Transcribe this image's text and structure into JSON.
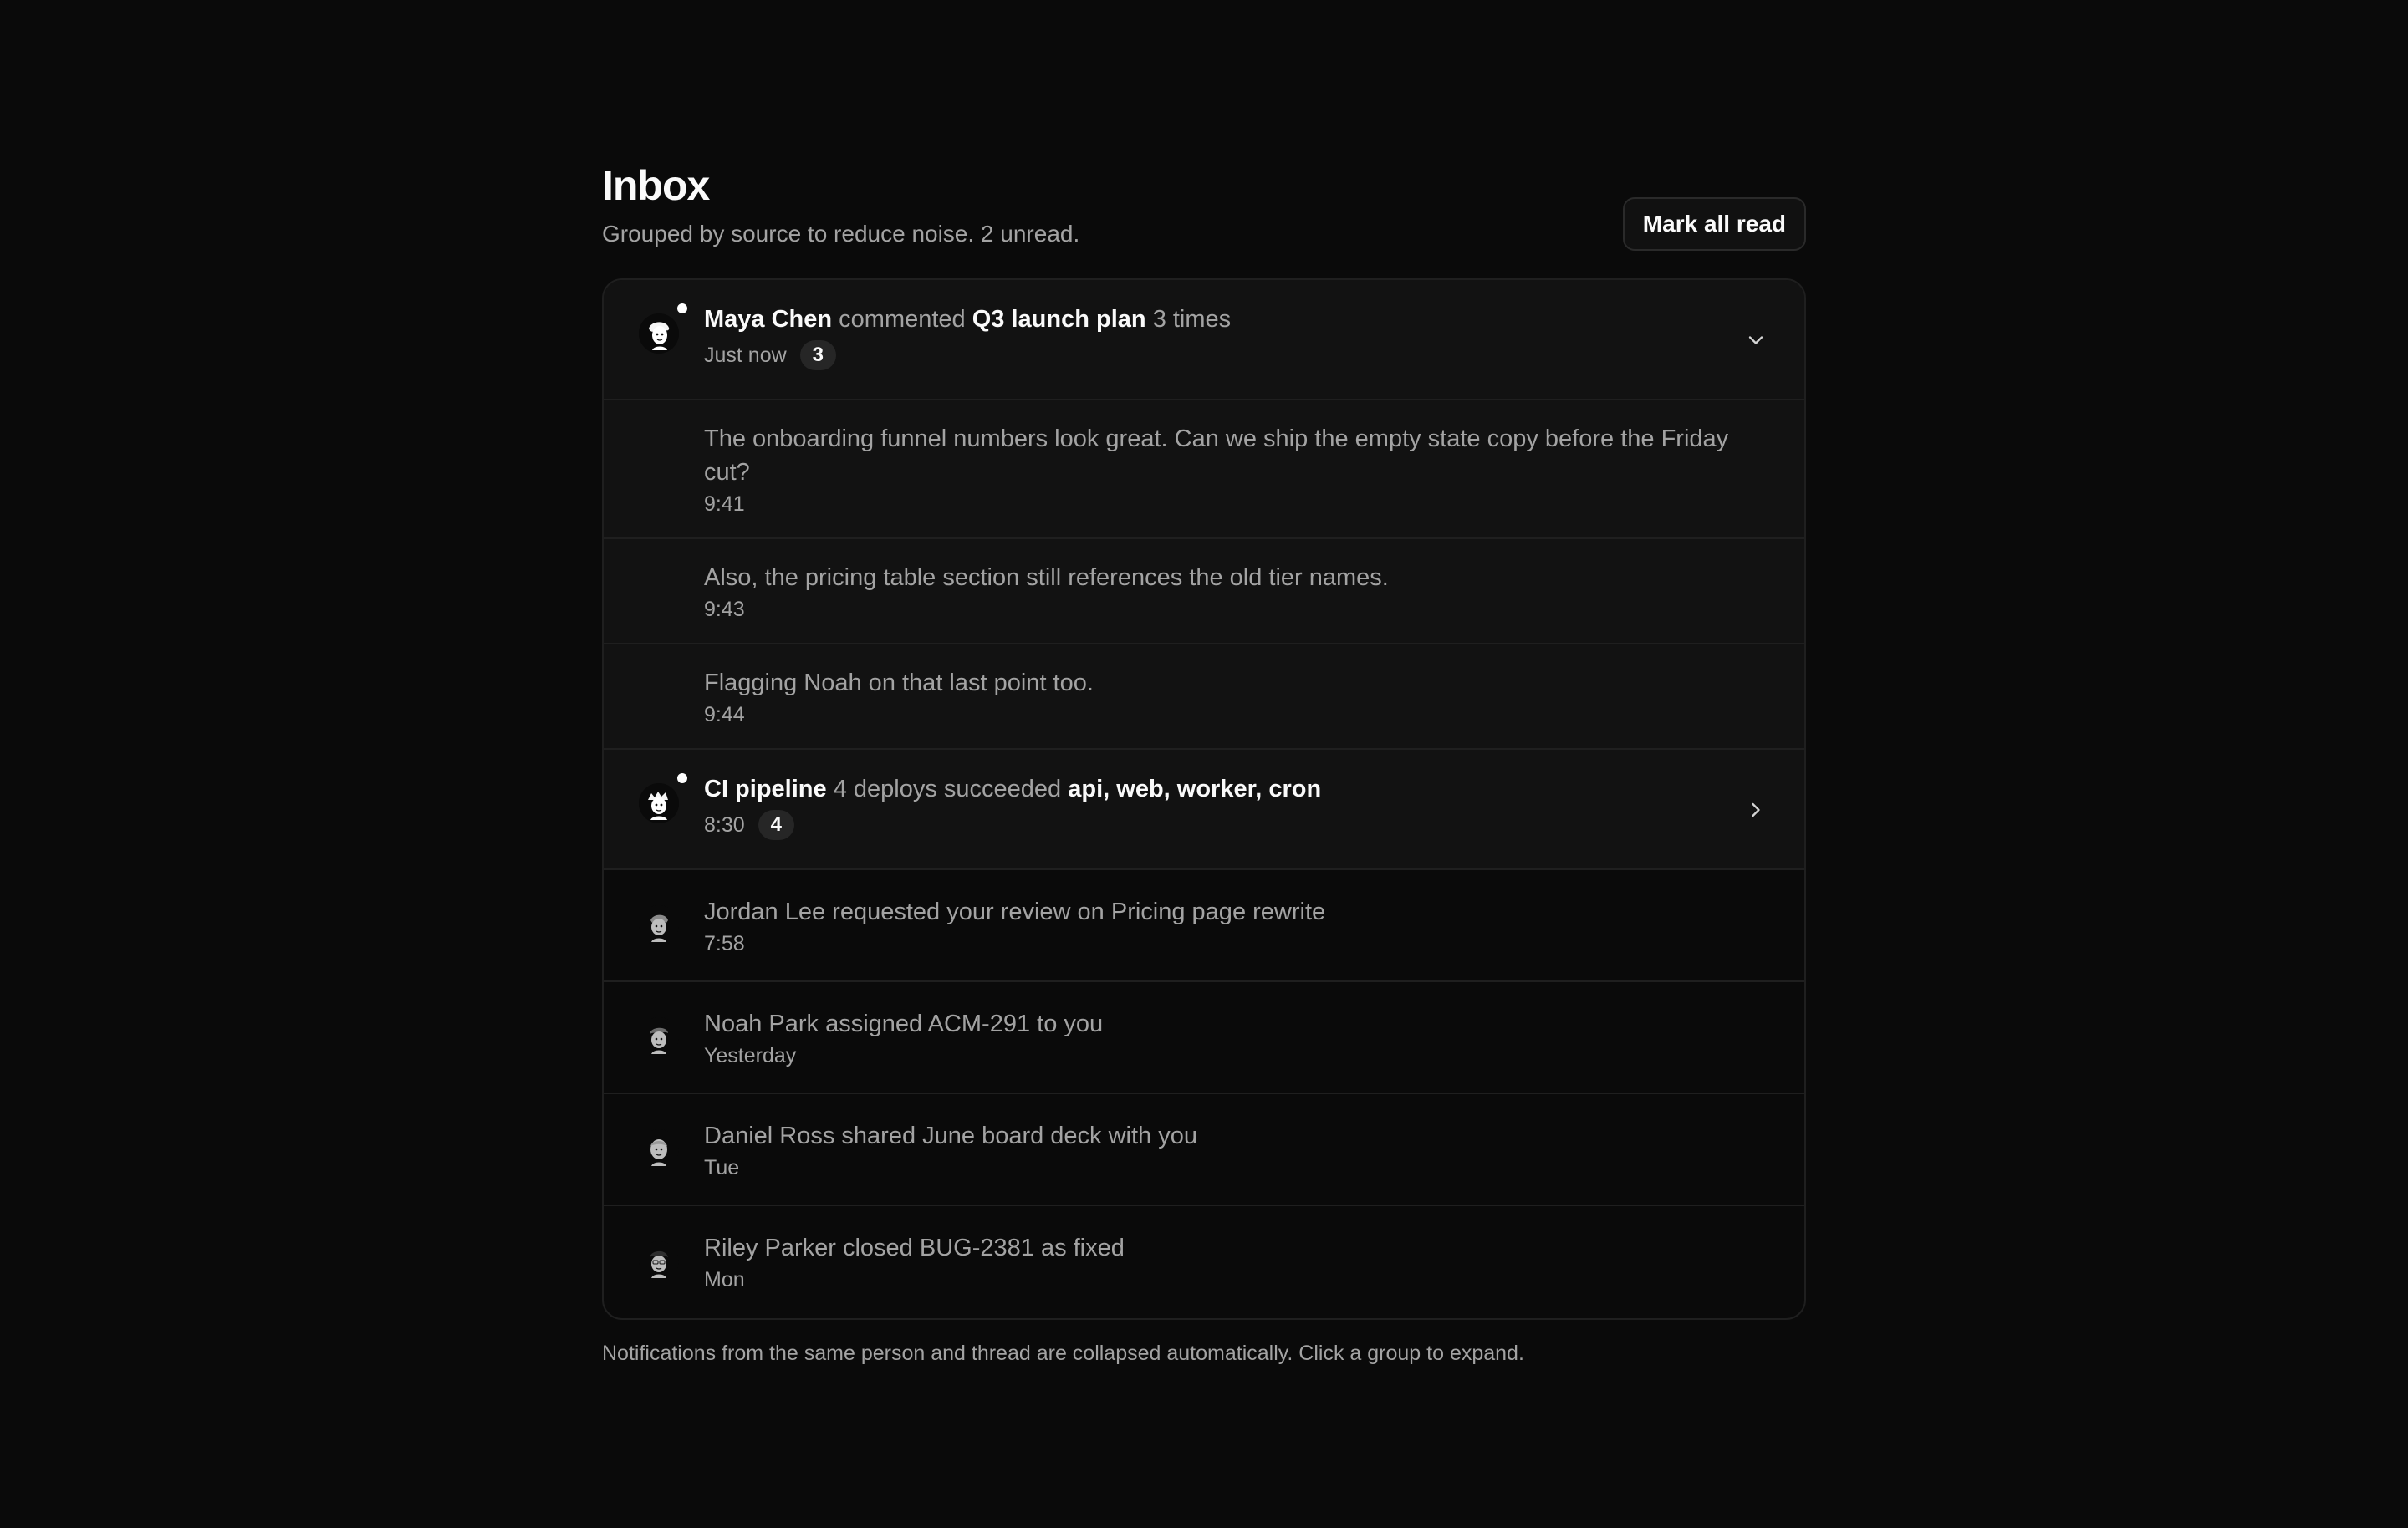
{
  "header": {
    "title": "Inbox",
    "subtitle": "Grouped by source to reduce noise. 2 unread.",
    "mark_all_read": "Mark all read"
  },
  "groups": [
    {
      "actor": "Maya Chen",
      "verb": "commented",
      "target": "Q3 launch plan",
      "suffix": "3 times",
      "time": "Just now",
      "count": "3",
      "unread": true,
      "expanded": true,
      "messages": [
        {
          "text": "The onboarding funnel numbers look great. Can we ship the empty state copy before the Friday cut?",
          "time": "9:41"
        },
        {
          "text": "Also, the pricing table section still references the old tier names.",
          "time": "9:43"
        },
        {
          "text": "Flagging Noah on that last point too.",
          "time": "9:44"
        }
      ]
    },
    {
      "actor": "CI pipeline",
      "verb": "4 deploys succeeded",
      "target": "api, web, worker, cron",
      "time": "8:30",
      "count": "4",
      "unread": true,
      "expanded": false
    }
  ],
  "items": [
    {
      "text": "Jordan Lee requested your review on Pricing page rewrite",
      "time": "7:58"
    },
    {
      "text": "Noah Park assigned ACM-291 to you",
      "time": "Yesterday"
    },
    {
      "text": "Daniel Ross shared June board deck with you",
      "time": "Tue"
    },
    {
      "text": "Riley Parker closed BUG-2381 as fixed",
      "time": "Mon"
    }
  ],
  "footer": "Notifications from the same person and thread are collapsed automatically. Click a group to expand.",
  "icons": {
    "chevron_down": "chevron-down-icon",
    "chevron_right": "chevron-right-icon",
    "avatar": "avatar-illustration"
  },
  "colors": {
    "background": "#0a0a0a",
    "surface": "#121212",
    "border": "#1f1f1f",
    "text_primary": "#fafafa",
    "text_muted": "#a3a3a3",
    "badge": "#262626",
    "unread_dot": "#ffffff"
  }
}
